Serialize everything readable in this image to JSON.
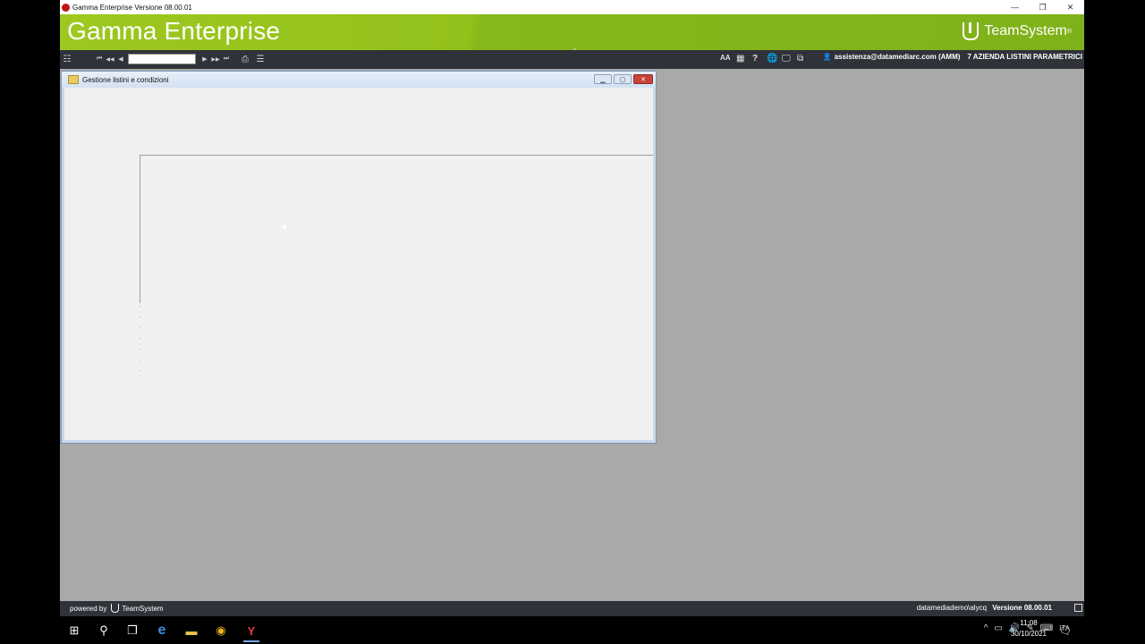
{
  "window": {
    "title": "Gamma Enterprise   Versione 08.00.01",
    "controls": {
      "minimize": "—",
      "restore": "❐",
      "close": "✕"
    }
  },
  "banner": {
    "product_name": "Gamma Enterprise",
    "brand": "TeamSystem",
    "brand_mark": "®"
  },
  "toolbar": {
    "menu_icon": "☷",
    "nav": {
      "first": "⏮",
      "prev_page": "◀◀",
      "prev": "◀",
      "record_value": "",
      "next": "▶",
      "next_page": "▶▶",
      "last": "⏭"
    },
    "print_icon": "⎙",
    "list_icon": "☰",
    "collapse_chevron": "⌃",
    "icons": {
      "font": "AA",
      "grid": "▦",
      "help": "?",
      "globe": "🌐",
      "monitor": "🖵",
      "windows": "⧉"
    },
    "user": "assistenza@datamediarc.com (AMM)",
    "company": "7 AZIENDA LISTINI PARAMETRICI"
  },
  "inner_window": {
    "title": "Gestione listini e condizioni",
    "controls": {
      "minimize": "▁",
      "maximize": "▢",
      "close": "✕"
    }
  },
  "statusbar": {
    "powered_by": "powered by",
    "brand": "TeamSystem",
    "db_info": "datamediademo\\alycq",
    "version": "Versione 08.00.01"
  },
  "taskbar": {
    "icons": [
      "windows-icon",
      "search-icon",
      "task-view-icon",
      "edge-icon",
      "file-explorer-icon",
      "chrome-icon",
      "gamma-icon"
    ],
    "glyphs": {
      "start": "⊞",
      "search": "⚲",
      "taskview": "❐",
      "edge": "e",
      "explorer": "▬",
      "chrome": "◉",
      "gamma": "Y"
    },
    "tray": {
      "chevron": "^",
      "network": "▭",
      "volume": "🔊",
      "pen": "✎",
      "keyboard": "⌨",
      "language": "ITA"
    },
    "time": "11:08",
    "date": "30/10/2021",
    "notification": "🗨"
  }
}
